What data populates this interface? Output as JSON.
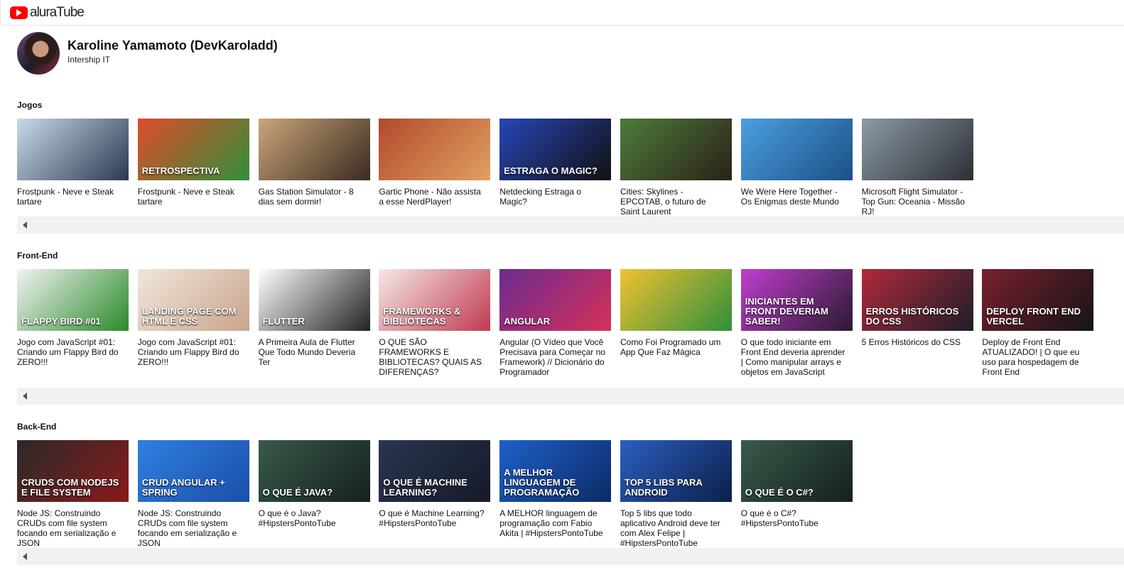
{
  "header": {
    "logo_text": "aluraTube"
  },
  "profile": {
    "name": "Karoline Yamamoto (DevKaroladd)",
    "role": "Intership IT"
  },
  "sections": [
    {
      "title": "Jogos",
      "videos": [
        {
          "title": "Frostpunk - Neve e Steak tartare",
          "thumb_text": "",
          "colors": [
            "#c8d9ea",
            "#2a3a52"
          ]
        },
        {
          "title": "Frostpunk - Neve e Steak tartare",
          "thumb_text": "RETROSPECTIVA",
          "colors": [
            "#e04b2a",
            "#2f8f3a"
          ]
        },
        {
          "title": "Gas Station Simulator - 8 dias sem dormir!",
          "thumb_text": "",
          "colors": [
            "#c9a57a",
            "#3a2a20"
          ]
        },
        {
          "title": "Gartic Phone - Não assista a esse NerdPlayer!",
          "thumb_text": "",
          "colors": [
            "#b24a2c",
            "#e0a060"
          ]
        },
        {
          "title": "Netdecking Estraga o Magic?",
          "thumb_text": "ESTRAGA O MAGIC?",
          "colors": [
            "#2646b8",
            "#111111"
          ]
        },
        {
          "title": "Cities: Skylines - EPCOTAB, o futuro de Saint Laurent",
          "thumb_text": "",
          "colors": [
            "#4c7c3a",
            "#2b2118"
          ]
        },
        {
          "title": "We Were Here Together - Os Enigmas deste Mundo",
          "thumb_text": "",
          "colors": [
            "#4aa0e0",
            "#1b4f86"
          ]
        },
        {
          "title": "Microsoft Flight Simulator - Top Gun: Oceania - Missão RJ!",
          "thumb_text": "",
          "colors": [
            "#8d9aa5",
            "#2c2f35"
          ]
        }
      ]
    },
    {
      "title": "Front-End",
      "videos": [
        {
          "title": "Jogo com JavaScript #01: Criando um Flappy Bird do ZERO!!!",
          "thumb_text": "Flappy Bird #01",
          "colors": [
            "#f2f2f2",
            "#2a8a2a"
          ]
        },
        {
          "title": "Jogo com JavaScript #01: Criando um Flappy Bird do ZERO!!!",
          "thumb_text": "LANDING PAGE COM HTML E CSS",
          "colors": [
            "#f1e6dc",
            "#c9a48a"
          ]
        },
        {
          "title": "A Primeira Aula de Flutter Que Todo Mundo Deveria Ter",
          "thumb_text": "Flutter",
          "colors": [
            "#ffffff",
            "#222222"
          ]
        },
        {
          "title": "O QUE SÃO FRAMEWORKS E BIBLIOTECAS? QUAIS AS DIFERENÇAS?",
          "thumb_text": "FRAMEWORKS & BIBLIOTECAS",
          "colors": [
            "#f5e8e6",
            "#c03a50"
          ]
        },
        {
          "title": "Angular (O Vídeo que Você Precisava para Começar no Framework) // Dicionário do Programador",
          "thumb_text": "ANGULAR",
          "colors": [
            "#6a2b90",
            "#d6305a"
          ]
        },
        {
          "title": "Como Foi Programado um App Que Faz Mágica",
          "thumb_text": "",
          "colors": [
            "#f0c232",
            "#2f8f3a"
          ]
        },
        {
          "title": "O que todo iniciante em Front End deveria aprender | Como manipular arrays e objetos em JavaScript",
          "thumb_text": "INICIANTES EM FRONT DEVERIAM SABER!",
          "colors": [
            "#c23dd0",
            "#2a1a30"
          ]
        },
        {
          "title": "5 Erros Históricos do CSS",
          "thumb_text": "ERROS HISTÓRICOS DO CSS",
          "colors": [
            "#b02a3a",
            "#1d1d2a"
          ]
        },
        {
          "title": "Deploy de Front End ATUALIZADO! | O que eu uso para hospedagem de Front End",
          "thumb_text": "DEPLOY FRONT END VERCEL",
          "colors": [
            "#7a2030",
            "#141414"
          ]
        }
      ]
    },
    {
      "title": "Back-End",
      "videos": [
        {
          "title": "Node JS: Construindo CRUDs com file system focando em serialização e JSON",
          "thumb_text": "CRUDS COM NODEJS E FILE SYSTEM",
          "colors": [
            "#2a2a2a",
            "#8a1a1a"
          ]
        },
        {
          "title": "Node JS: Construindo CRUDs com file system focando em serialização e JSON",
          "thumb_text": "CRUD ANGULAR + SPRING",
          "colors": [
            "#2f7fe0",
            "#1a4fa8"
          ]
        },
        {
          "title": "O que é o Java? #HipstersPontoTube",
          "thumb_text": "O QUE É JAVA?",
          "colors": [
            "#3a5a4a",
            "#14211c"
          ]
        },
        {
          "title": "O que é Machine Learning? #HipstersPontoTube",
          "thumb_text": "O QUE É MACHINE LEARNING?",
          "colors": [
            "#2a3550",
            "#151a28"
          ]
        },
        {
          "title": "A MELHOR linguagem de programação com Fabio Akita | #HipstersPontoTube",
          "thumb_text": "A MELHOR LINGUAGEM DE PROGRAMAÇÃO",
          "colors": [
            "#1d60c8",
            "#0c2a66"
          ]
        },
        {
          "title": "Top 5 libs que todo aplicativo Android deve ter com Alex Felipe | #HipstersPontoTube",
          "thumb_text": "TOP 5 LIBS PARA ANDROID",
          "colors": [
            "#2a5fc0",
            "#0d1f4a"
          ]
        },
        {
          "title": "O que é o C#? #HipstersPontoTube",
          "thumb_text": "O QUE É O C#?",
          "colors": [
            "#3a5a4a",
            "#14211c"
          ]
        }
      ]
    }
  ]
}
